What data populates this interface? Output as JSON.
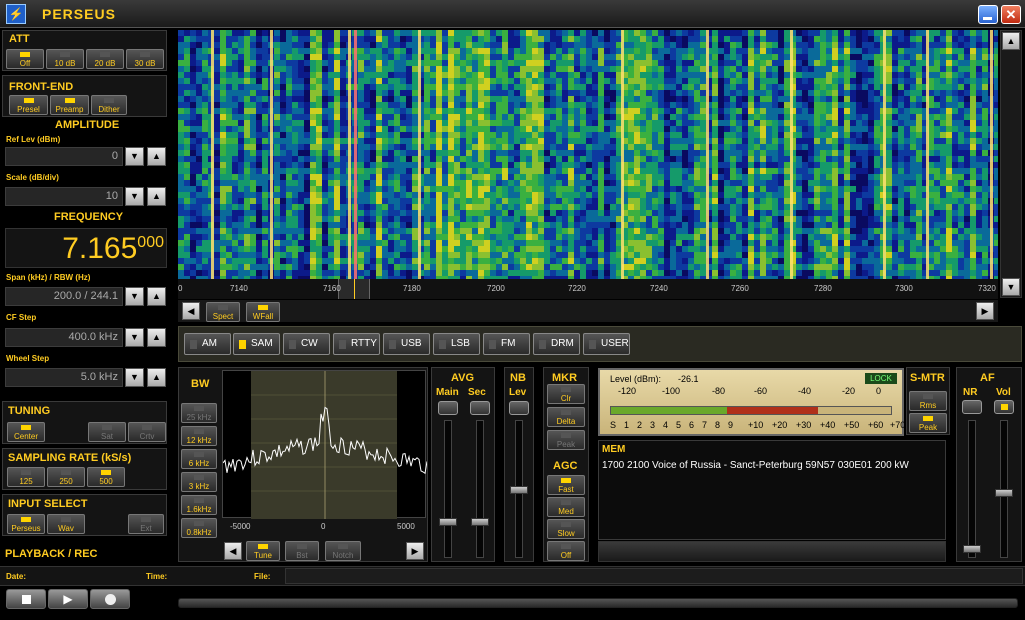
{
  "window": {
    "title": "PERSEUS"
  },
  "att": {
    "title": "ATT",
    "buttons": [
      "Off",
      "10 dB",
      "20 dB",
      "30 dB"
    ]
  },
  "frontend": {
    "title": "FRONT-END",
    "buttons": [
      "Presel",
      "Preamp",
      "Dither"
    ]
  },
  "amplitude": {
    "title": "AMPLITUDE",
    "ref_label": "Ref Lev (dBm)",
    "ref_value": "0",
    "scale_label": "Scale (dB/div)",
    "scale_value": "10"
  },
  "frequency": {
    "title": "FREQUENCY",
    "main": "7.165",
    "sub": "000",
    "span_label": "Span (kHz) / RBW (Hz)",
    "span_value": "200.0 / 244.1",
    "cf_label": "CF Step",
    "cf_value": "400.0 kHz",
    "wheel_label": "Wheel Step",
    "wheel_value": "5.0 kHz"
  },
  "tuning": {
    "title": "TUNING",
    "buttons": [
      "Center",
      "Sat",
      "Crtv"
    ]
  },
  "sampling": {
    "title": "SAMPLING RATE (kS/s)",
    "buttons": [
      "125",
      "250",
      "500"
    ]
  },
  "input": {
    "title": "INPUT SELECT",
    "buttons": [
      "Perseus",
      "Wav",
      "Ext"
    ]
  },
  "playback": {
    "title": "PLAYBACK / REC",
    "date_label": "Date:",
    "time_label": "Time:",
    "file_label": "File:"
  },
  "spectrum": {
    "ticks": [
      "7140",
      "7160",
      "7180",
      "7200",
      "7220",
      "7240",
      "7260",
      "7280",
      "7300",
      "7320"
    ],
    "first_tick": "0",
    "view_buttons": [
      "Spect",
      "WFall"
    ]
  },
  "modes": [
    "AM",
    "SAM",
    "CW",
    "RTTY",
    "USB",
    "LSB",
    "FM",
    "DRM",
    "USER"
  ],
  "bw": {
    "title": "BW",
    "buttons": [
      "25 kHz",
      "12 kHz",
      "6 kHz",
      "3 kHz",
      "1.6kHz",
      "0.8kHz"
    ],
    "axis": [
      "-5000",
      "0",
      "5000"
    ],
    "bottom_buttons": [
      "Tune",
      "Bst",
      "Notch"
    ]
  },
  "avg": {
    "title": "AVG",
    "main": "Main",
    "sec": "Sec"
  },
  "nb": {
    "title": "NB",
    "lev": "Lev"
  },
  "mkr": {
    "title": "MKR",
    "buttons": [
      "Clr",
      "Delta",
      "Peak"
    ]
  },
  "agc": {
    "title": "AGC",
    "buttons": [
      "Fast",
      "Med",
      "Slow",
      "Off"
    ]
  },
  "meter": {
    "level_label": "Level (dBm):",
    "level_value": "-26.1",
    "lock": "LOCK",
    "top_scale": [
      "-120",
      "-100",
      "-80",
      "-60",
      "-40",
      "-20",
      "0"
    ],
    "bottom_scale": [
      "S",
      "1",
      "2",
      "3",
      "4",
      "5",
      "6",
      "7",
      "8",
      "9",
      "+10",
      "+20",
      "+30",
      "+40",
      "+50",
      "+60",
      "+70"
    ],
    "level_fraction": 0.74
  },
  "smtr": {
    "title": "S-MTR",
    "buttons": [
      "Rms",
      "Peak"
    ]
  },
  "af": {
    "title": "AF",
    "nr": "NR",
    "vol": "Vol"
  },
  "mem": {
    "title": "MEM",
    "entry": "1700 2100 Voice of Russia - Sanct-Peterburg  59N57 030E01 200 kW"
  },
  "colors": {
    "accent": "#ffcc22",
    "led_on": "#ffd400",
    "meter_green": "#6aa82a",
    "meter_red": "#b0301a",
    "spectrum_line": "#ffffff"
  }
}
